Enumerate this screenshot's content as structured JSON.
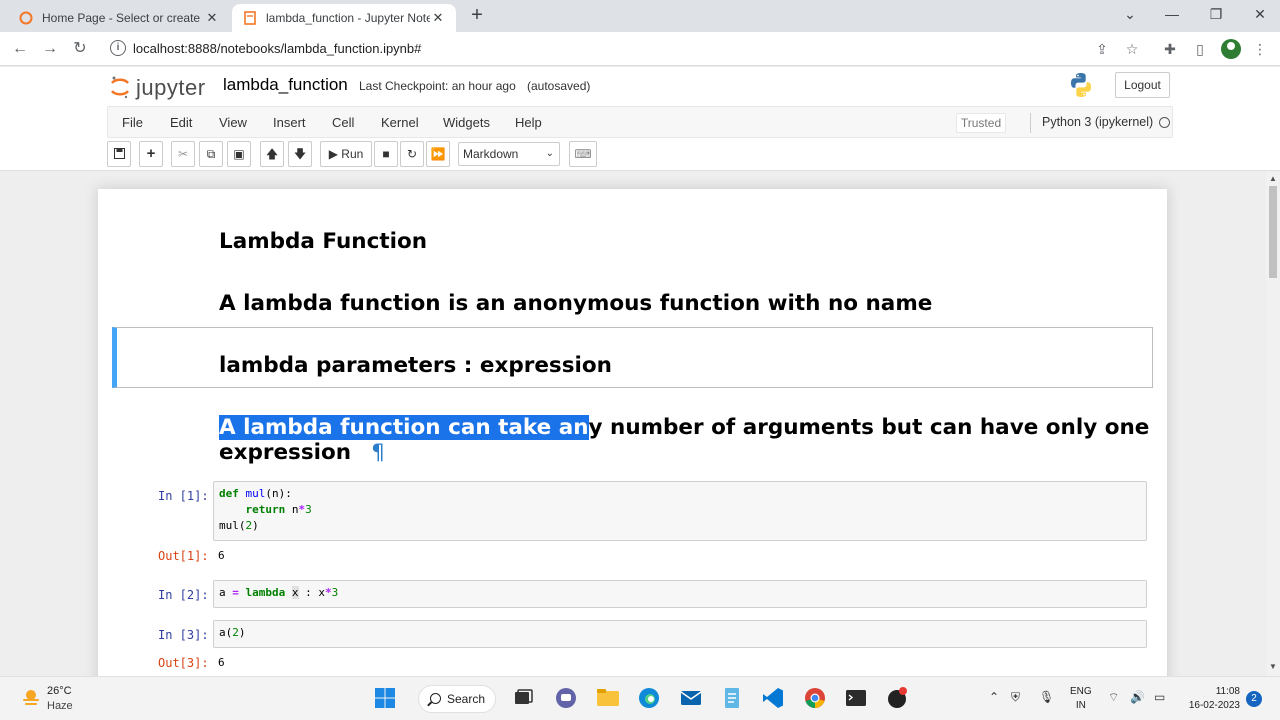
{
  "browser": {
    "tabs": [
      {
        "title": "Home Page - Select or create a n",
        "active": false
      },
      {
        "title": "lambda_function - Jupyter Noteb",
        "active": true
      }
    ],
    "new_tab": "+",
    "url": "localhost:8888/notebooks/lambda_function.ipynb#",
    "window_controls": {
      "minimize": "—",
      "restore": "❐",
      "close": "✕",
      "tab_search": "⌄"
    }
  },
  "jupyter": {
    "logo_text": "jupyter",
    "notebook_name": "lambda_function",
    "checkpoint": "Last Checkpoint: an hour ago",
    "autosaved": "(autosaved)",
    "logout": "Logout",
    "menu": [
      "File",
      "Edit",
      "View",
      "Insert",
      "Cell",
      "Kernel",
      "Widgets",
      "Help"
    ],
    "trusted": "Trusted",
    "kernel": "Python 3 (ipykernel)",
    "run_label": "Run",
    "cell_type": "Markdown",
    "accent_color": "#42a5f5"
  },
  "notebook": {
    "heading1": "Lambda Function",
    "heading2": "A lambda function is an anonymous function with no name",
    "heading3": "lambda parameters : expression",
    "heading4_selected": "A lambda function can take an",
    "heading4_rest": "y number of arguments but can have only one",
    "heading4_line2": "expression",
    "pilcrow": "¶",
    "cells": [
      {
        "in_prompt": "In [1]:",
        "code": [
          "def mul(n):",
          "    return n*3",
          "mul(2)"
        ],
        "out_prompt": "Out[1]:",
        "output": "6"
      },
      {
        "in_prompt": "In [2]:",
        "code": [
          "a = lambda x : x*3"
        ]
      },
      {
        "in_prompt": "In [3]:",
        "code": [
          "a(2)"
        ],
        "out_prompt": "Out[3]:",
        "output": "6"
      }
    ]
  },
  "taskbar": {
    "weather_temp": "26°C",
    "weather_desc": "Haze",
    "search": "Search",
    "lang_top": "ENG",
    "lang_bottom": "IN",
    "time": "11:08",
    "date": "16-02-2023",
    "notifications": "2"
  }
}
